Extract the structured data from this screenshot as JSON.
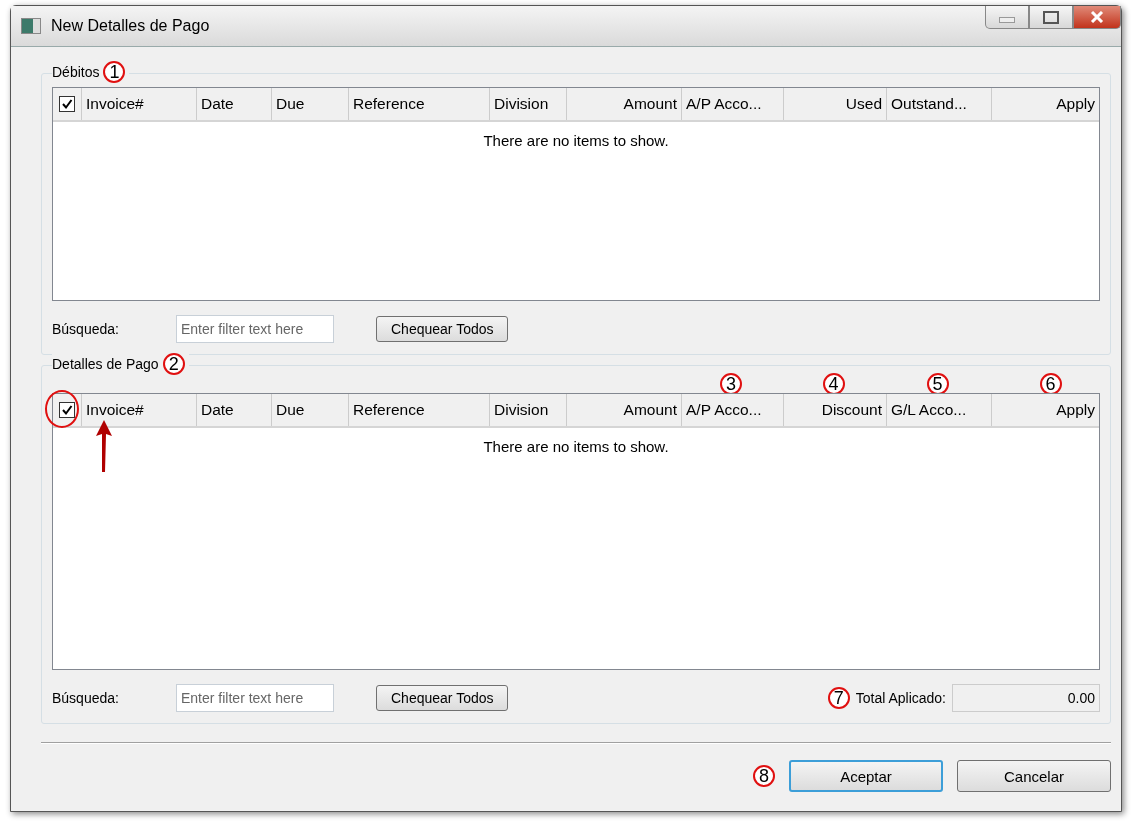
{
  "window": {
    "title": "New Detalles de Pago"
  },
  "sections": [
    {
      "legend": "Débitos",
      "callout": "1",
      "table": {
        "header_checkbox": {
          "checked": true
        },
        "columns": [
          {
            "label": "Invoice#",
            "kind": "text"
          },
          {
            "label": "Date",
            "kind": "text"
          },
          {
            "label": "Due",
            "kind": "text"
          },
          {
            "label": "Reference",
            "kind": "text"
          },
          {
            "label": "Division",
            "kind": "text"
          },
          {
            "label": "Amount",
            "kind": "number"
          },
          {
            "label": "A/P Acco...",
            "kind": "text"
          },
          {
            "label": "Used",
            "kind": "number"
          },
          {
            "label": "Outstand...",
            "kind": "text"
          },
          {
            "label": "Apply",
            "kind": "number"
          }
        ],
        "empty_message": "There are no items to show."
      },
      "search": {
        "label": "Búsqueda:",
        "placeholder": "Enter filter text here"
      },
      "check_all_button": "Chequear Todos"
    },
    {
      "legend": "Detalles de Pago",
      "callout": "2",
      "table": {
        "header_checkbox": {
          "checked": true,
          "circled": true
        },
        "columns": [
          {
            "label": "Invoice#",
            "kind": "text"
          },
          {
            "label": "Date",
            "kind": "text"
          },
          {
            "label": "Due",
            "kind": "text"
          },
          {
            "label": "Reference",
            "kind": "text"
          },
          {
            "label": "Division",
            "kind": "text"
          },
          {
            "label": "Amount",
            "kind": "number"
          },
          {
            "label": "A/P Acco...",
            "kind": "text",
            "callout": "3"
          },
          {
            "label": "Discount",
            "kind": "number",
            "callout": "4"
          },
          {
            "label": "G/L Acco...",
            "kind": "text",
            "callout": "5"
          },
          {
            "label": "Apply",
            "kind": "number",
            "callout": "6"
          }
        ],
        "empty_message": "There are no items to show."
      },
      "search": {
        "label": "Búsqueda:",
        "placeholder": "Enter filter text here"
      },
      "check_all_button": "Chequear Todos",
      "total": {
        "callout": "7",
        "label": "Total Aplicado:",
        "value": "0.00"
      }
    }
  ],
  "buttons": [
    {
      "label": "Aceptar",
      "default": true,
      "callout": "8"
    },
    {
      "label": "Cancelar",
      "default": false
    }
  ]
}
